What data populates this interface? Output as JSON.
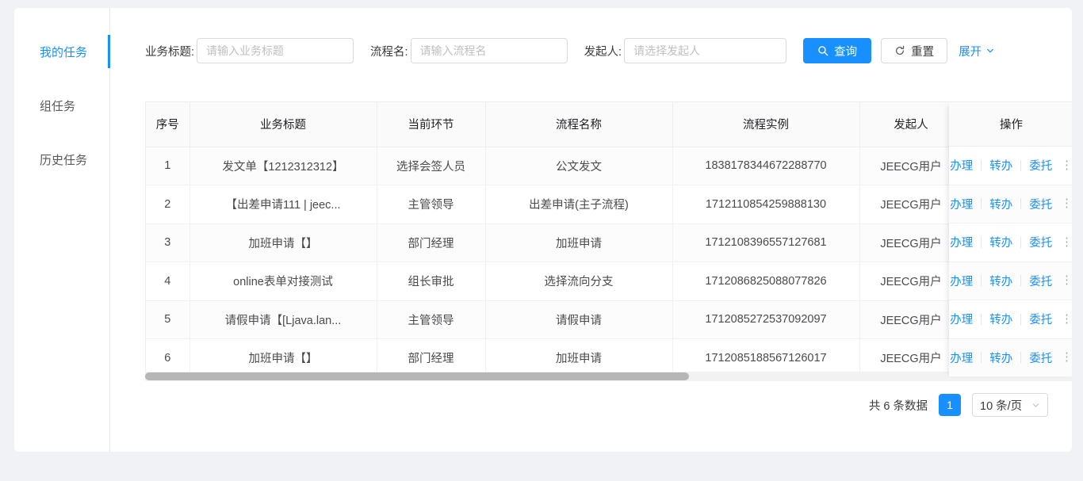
{
  "sidebar": {
    "items": [
      {
        "label": "我的任务",
        "active": true
      },
      {
        "label": "组任务",
        "active": false
      },
      {
        "label": "历史任务",
        "active": false
      }
    ]
  },
  "search": {
    "fields": [
      {
        "label": "业务标题:",
        "placeholder": "请输入业务标题",
        "value": ""
      },
      {
        "label": "流程名:",
        "placeholder": "请输入流程名",
        "value": ""
      },
      {
        "label": "发起人:",
        "placeholder": "请选择发起人",
        "value": ""
      }
    ],
    "query_button": "查询",
    "query_icon": "search-icon",
    "reset_button": "重置",
    "reset_icon": "refresh-icon",
    "expand_link": "展开",
    "expand_icon": "chevron-down-icon"
  },
  "table": {
    "columns": [
      "序号",
      "业务标题",
      "当前环节",
      "流程名称",
      "流程实例",
      "发起人",
      "操作"
    ],
    "rows": [
      {
        "idx": "1",
        "title": "发文单【1212312312】",
        "node": "选择会签人员",
        "flow": "公文发文",
        "instance": "1838178344672288770",
        "user": "JEECG用户"
      },
      {
        "idx": "2",
        "title": "【出差申请111 | jeec...",
        "node": "主管领导",
        "flow": "出差申请(主子流程)",
        "instance": "1712110854259888130",
        "user": "JEECG用户"
      },
      {
        "idx": "3",
        "title": "加班申请【】",
        "node": "部门经理",
        "flow": "加班申请",
        "instance": "1712108396557127681",
        "user": "JEECG用户"
      },
      {
        "idx": "4",
        "title": "online表单对接测试",
        "node": "组长审批",
        "flow": "选择流向分支",
        "instance": "1712086825088077826",
        "user": "JEECG用户"
      },
      {
        "idx": "5",
        "title": "请假申请【[Ljava.lan...",
        "node": "主管领导",
        "flow": "请假申请",
        "instance": "1712085272537092097",
        "user": "JEECG用户"
      },
      {
        "idx": "6",
        "title": "加班申请【】",
        "node": "部门经理",
        "flow": "加班申请",
        "instance": "1712085188567126017",
        "user": "JEECG用户"
      }
    ],
    "actions": [
      "办理",
      "转办",
      "委托"
    ],
    "more_actions": "⋮"
  },
  "pagination": {
    "total_text": "共 6 条数据",
    "current_page": "1",
    "page_size": "10 条/页",
    "page_size_icon": "chevron-down-icon"
  },
  "colors": {
    "accent": "#1890ff",
    "page_bg": "#f0f2f5",
    "header_bg": "#fafafa",
    "border": "#ebedf0",
    "placeholder": "#bfbfbf"
  }
}
